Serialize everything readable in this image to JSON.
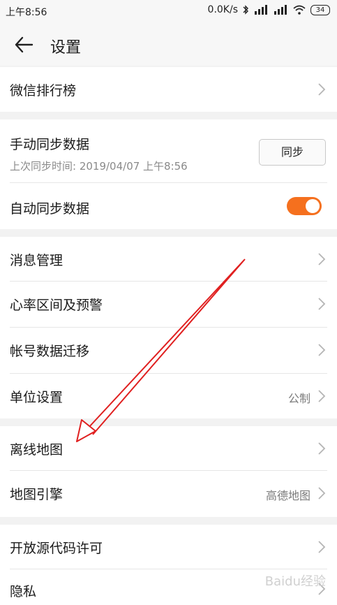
{
  "status_bar": {
    "time": "上午8:56",
    "net_speed": "0.0K/s",
    "battery": "34"
  },
  "header": {
    "title": "设置"
  },
  "sections": {
    "s1": {
      "wechat_rank": "微信排行榜"
    },
    "s2": {
      "manual_sync": "手动同步数据",
      "last_sync": "上次同步时间: 2019/04/07 上午8:56",
      "sync_button": "同步",
      "auto_sync": "自动同步数据",
      "auto_sync_enabled": true
    },
    "s3": {
      "messages": "消息管理",
      "heart_rate": "心率区间及预警",
      "account_migrate": "帐号数据迁移",
      "units": "单位设置",
      "units_value": "公制"
    },
    "s4": {
      "offline_map": "离线地图",
      "map_engine": "地图引擎",
      "map_engine_value": "高德地图"
    },
    "s5": {
      "open_source": "开放源代码许可",
      "privacy": "隐私"
    }
  },
  "colors": {
    "accent": "#f5701e",
    "annotation_arrow": "#e02020"
  },
  "watermark": "Baidu经验"
}
